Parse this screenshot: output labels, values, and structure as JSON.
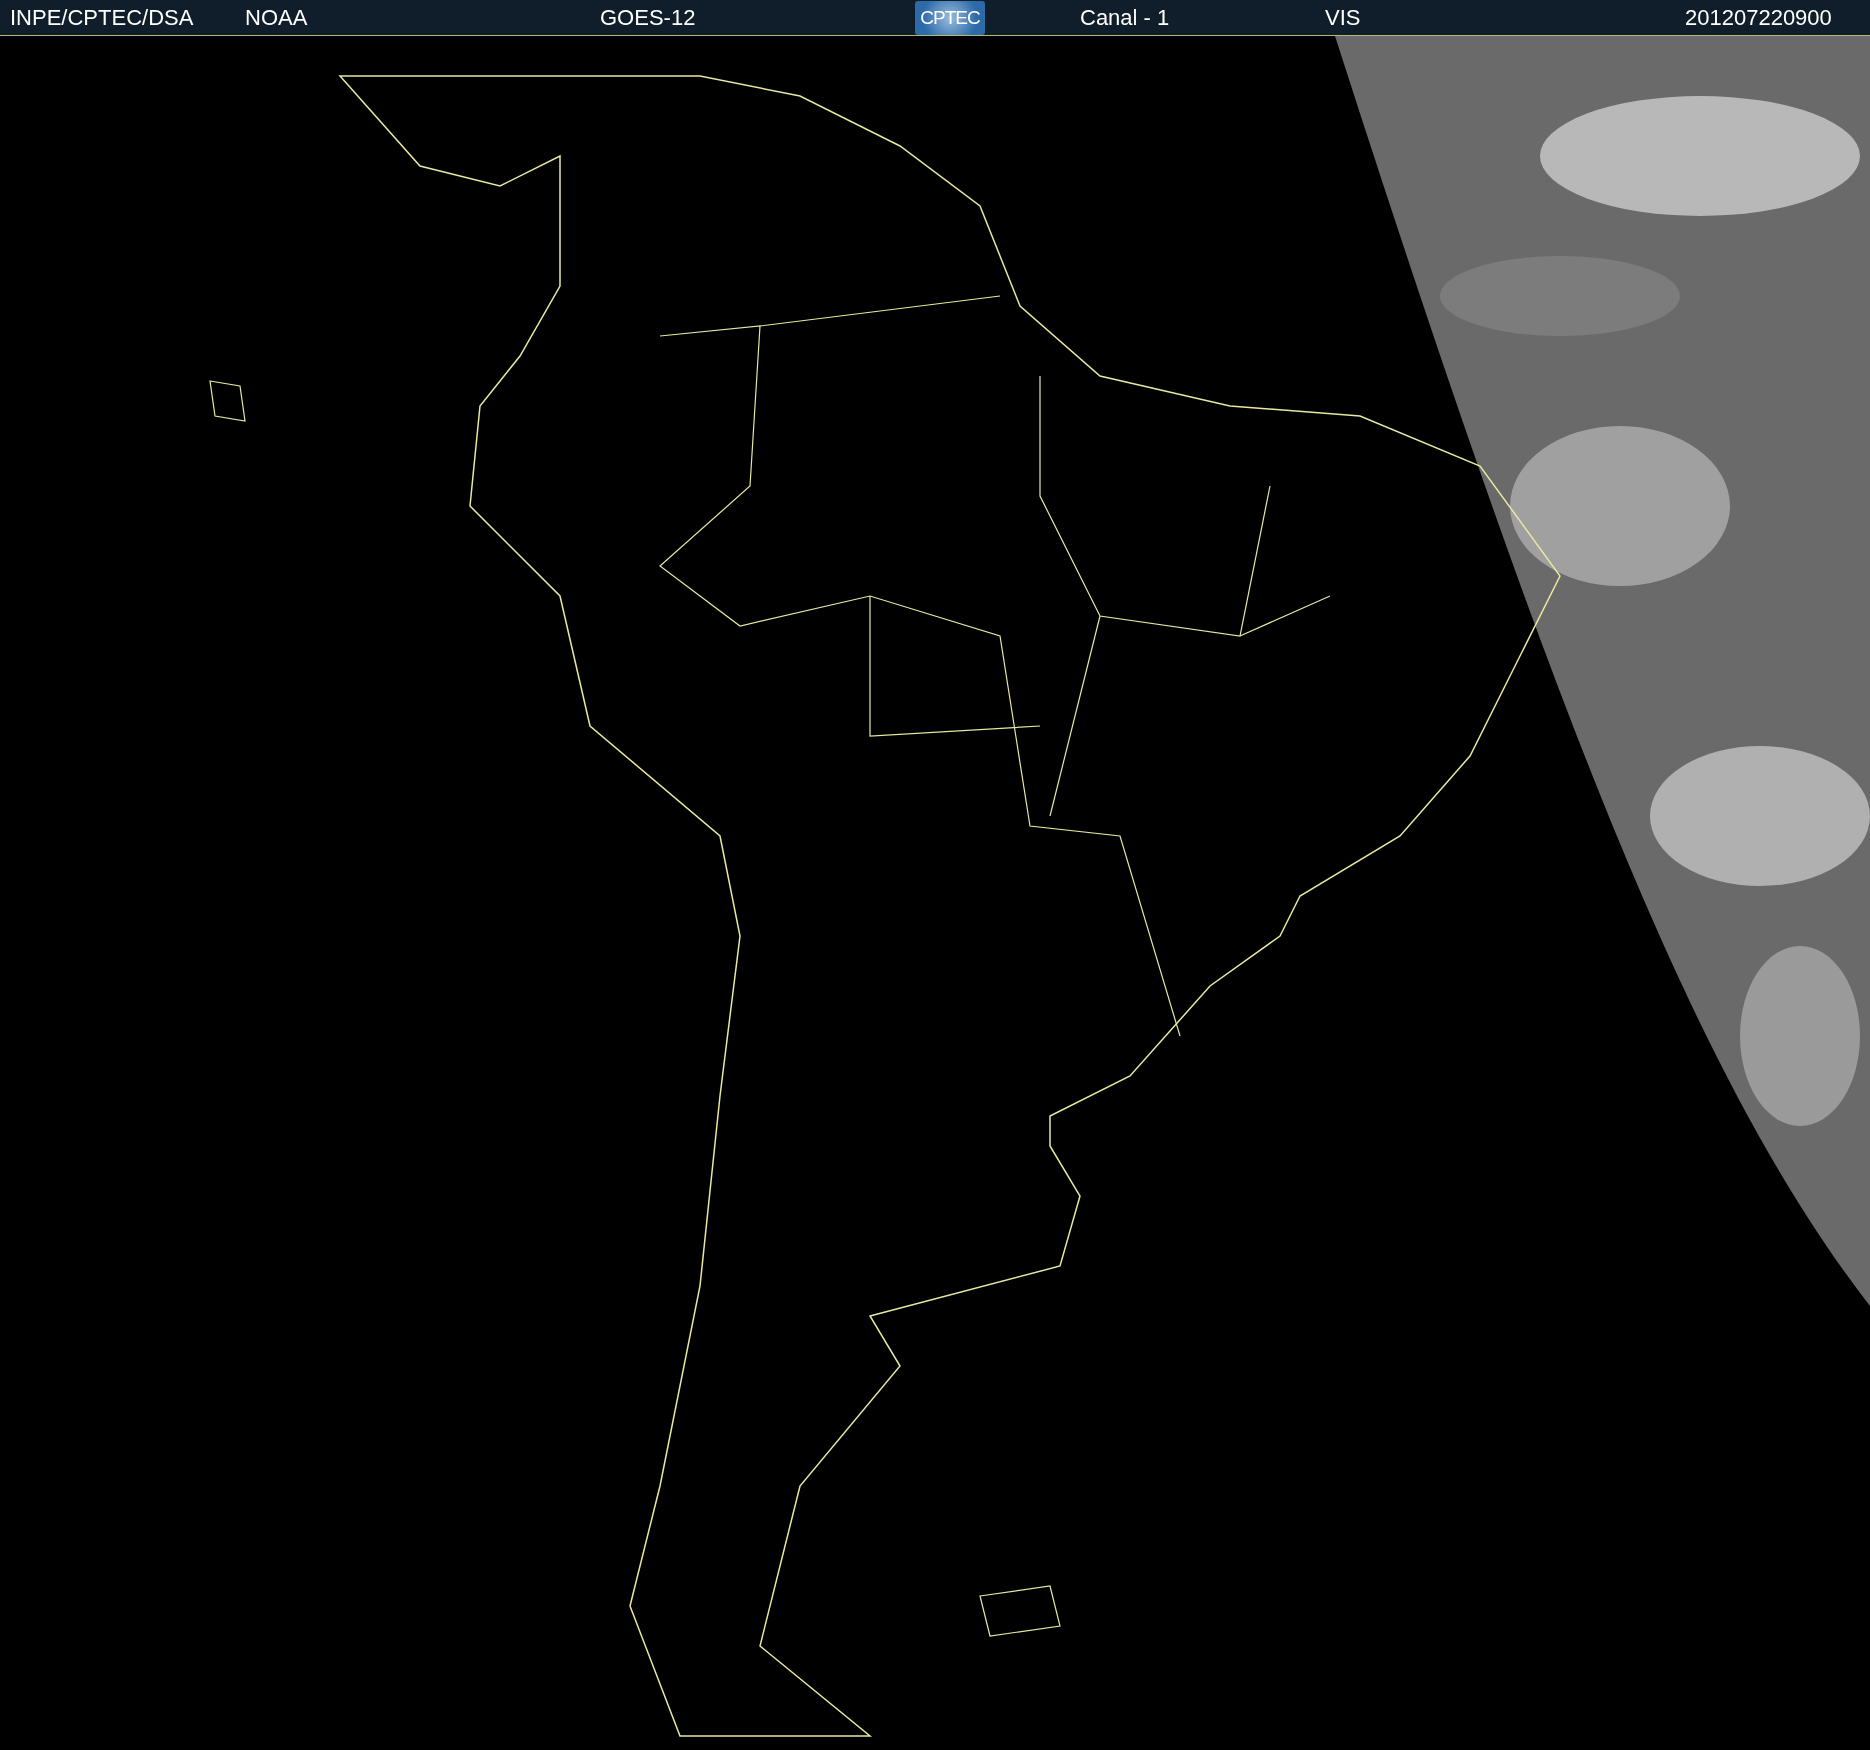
{
  "header": {
    "source": "INPE/CPTEC/DSA",
    "agency": "NOAA",
    "satellite": "GOES-12",
    "logo": "CPTEC",
    "channel": "Canal - 1",
    "band": "VIS",
    "timestamp": "201207220900"
  }
}
